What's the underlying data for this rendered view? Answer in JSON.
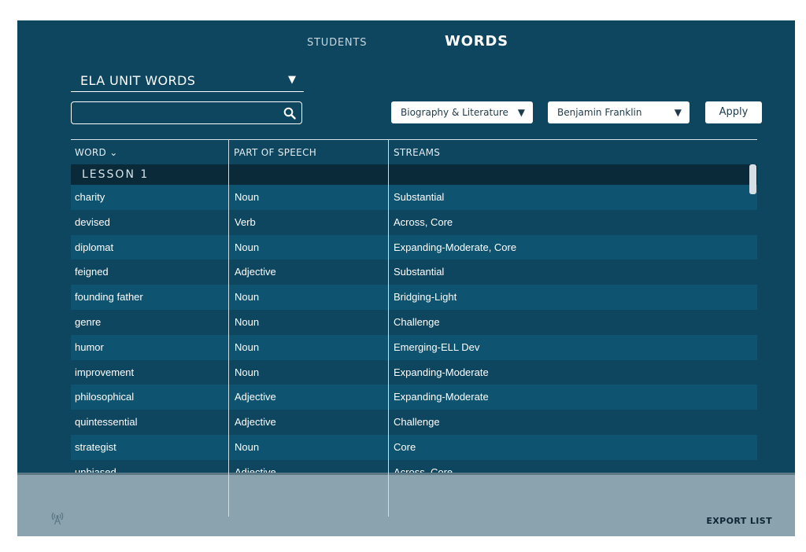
{
  "tabs": {
    "students": "STUDENTS",
    "words": "WORDS"
  },
  "unit_select": {
    "label": "ELA UNIT WORDS",
    "arrow": "▼"
  },
  "search": {
    "value": "",
    "placeholder": ""
  },
  "filters": {
    "category": {
      "label": "Biography & Literature",
      "arrow": "▼"
    },
    "person": {
      "label": "Benjamin Franklin",
      "arrow": "▼"
    },
    "apply": "Apply"
  },
  "table": {
    "headers": {
      "word": "WORD ⌄",
      "part_of_speech": "PART OF SPEECH",
      "streams": "STREAMS"
    },
    "lesson": "LESSON 1",
    "rows": [
      {
        "word": "charity",
        "pos": "Noun",
        "streams": "Substantial"
      },
      {
        "word": "devised",
        "pos": "Verb",
        "streams": "Across, Core"
      },
      {
        "word": "diplomat",
        "pos": "Noun",
        "streams": "Expanding-Moderate, Core"
      },
      {
        "word": "feigned",
        "pos": "Adjective",
        "streams": "Substantial"
      },
      {
        "word": "founding father",
        "pos": "Noun",
        "streams": "Bridging-Light"
      },
      {
        "word": "genre",
        "pos": "Noun",
        "streams": "Challenge"
      },
      {
        "word": "humor",
        "pos": "Noun",
        "streams": "Emerging-ELL Dev"
      },
      {
        "word": "improvement",
        "pos": "Noun",
        "streams": "Expanding-Moderate"
      },
      {
        "word": "philosophical",
        "pos": "Adjective",
        "streams": "Expanding-Moderate"
      },
      {
        "word": "quintessential",
        "pos": "Adjective",
        "streams": "Challenge"
      },
      {
        "word": "strategist",
        "pos": "Noun",
        "streams": "Core"
      },
      {
        "word": "unbiased",
        "pos": "Adjective",
        "streams": "Across, Core"
      }
    ]
  },
  "footer": {
    "export": "EXPORT LIST",
    "status_icon": "signal-icon"
  },
  "colors": {
    "background": "#0e4660",
    "row_alt": "#0e536f",
    "lesson_bar": "#0b2a39",
    "footer": "#8ba3af"
  }
}
